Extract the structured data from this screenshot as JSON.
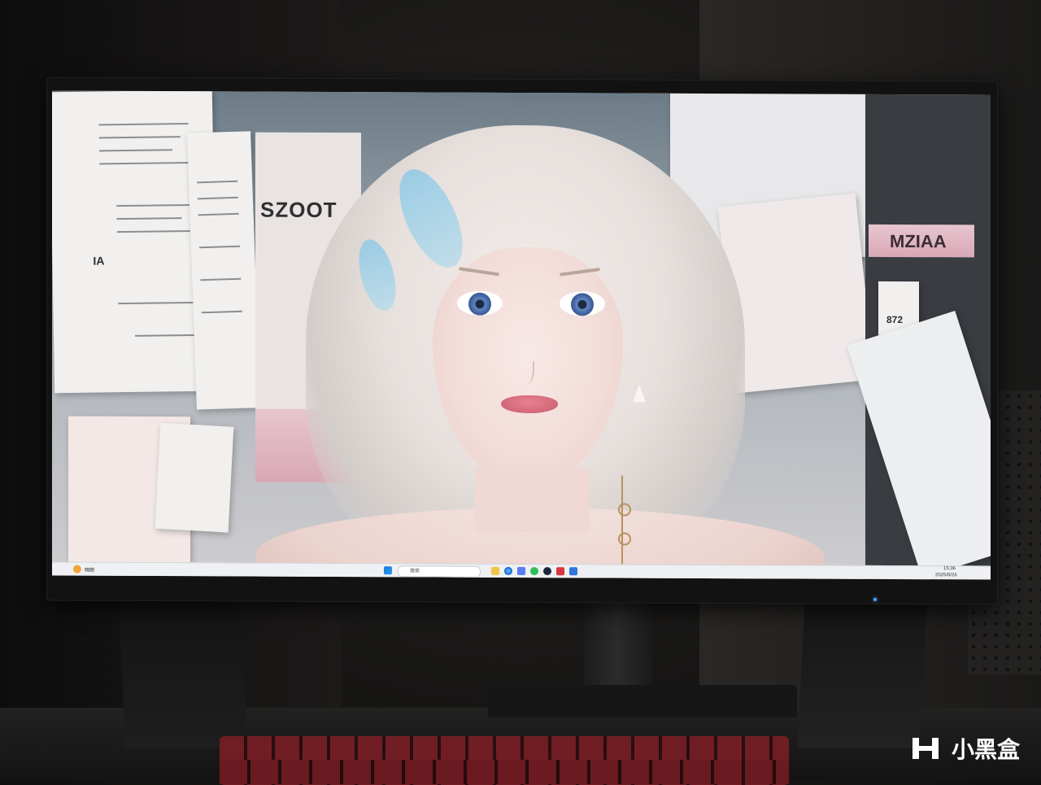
{
  "wallpaper": {
    "poster_left_heading": "SZOOT",
    "poster_right_heading": "MZIAA",
    "sticker_text": "872",
    "paper_caption": "IA"
  },
  "taskbar": {
    "search_placeholder": "搜索",
    "clock_time": "15:36",
    "clock_date": "2025/8/26",
    "weather_label": "晴朗"
  },
  "icons": [
    "windows-start-icon",
    "search-icon",
    "file-explorer-icon",
    "browser-icon",
    "store-icon",
    "steam-icon",
    "chat-icon"
  ],
  "watermark": {
    "brand": "小黑盒"
  }
}
